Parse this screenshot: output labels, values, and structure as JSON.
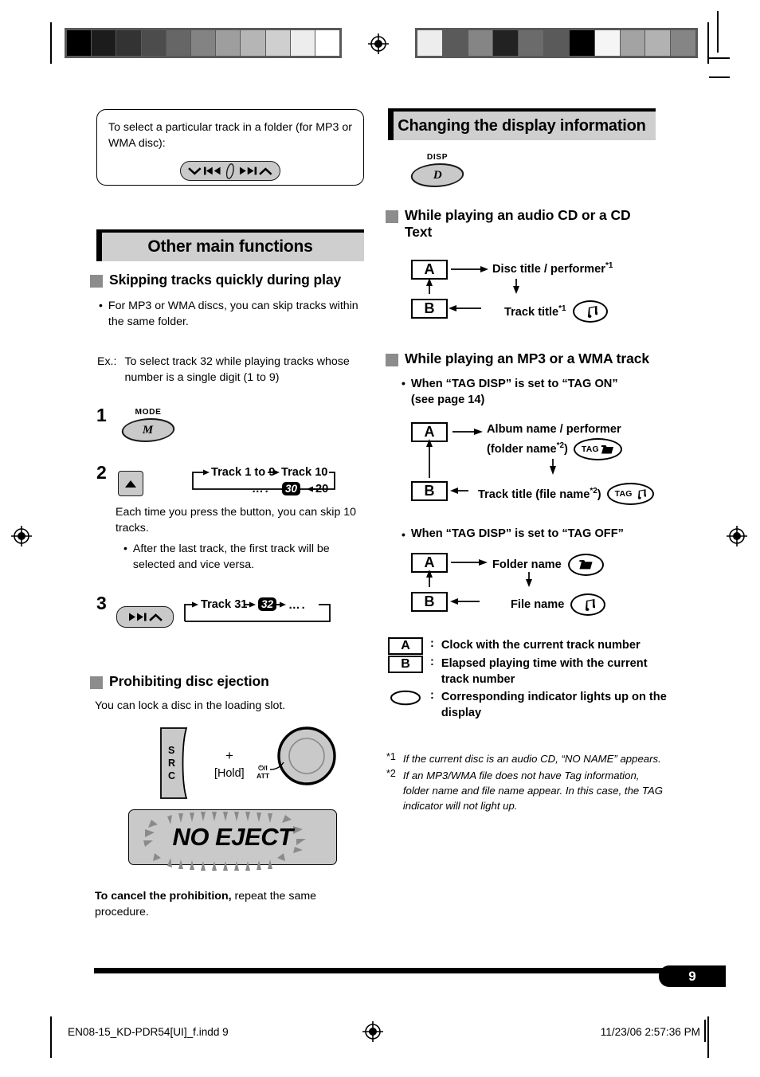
{
  "page": {
    "number": "9",
    "footer_file": "EN08-15_KD-PDR54[UI]_f.indd   9",
    "footer_date": "11/23/06   2:57:36 PM"
  },
  "left_column": {
    "intro_note": {
      "text": "To select a particular track in a folder (for MP3 or WMA disc):",
      "key_icon": "rocker-skip-key"
    },
    "banner": {
      "title": "Other main functions"
    },
    "section1": {
      "heading": "Skipping tracks quickly during play",
      "bullet": "For MP3 or WMA discs, you can skip tracks within the same folder.",
      "example_label": "Ex.:",
      "example_text": "To select track 32 while playing tracks whose number is a single digit (1 to 9)",
      "step1": {
        "num": "1",
        "key_label": "MODE",
        "key_glyph": "M"
      },
      "step2": {
        "num": "2",
        "key_icon": "up-arrow-key",
        "flow_top": [
          "Track 1 to 9",
          "Track 10"
        ],
        "flow_bottom": [
          "….",
          "30",
          "20"
        ],
        "text": "Each time you press the button, you can skip 10 tracks.",
        "bullet": "After the last track, the first track will be selected and vice versa."
      },
      "step3": {
        "num": "3",
        "key_icon": "fast-forward-key",
        "flow": [
          "Track 31",
          "32",
          "…."
        ]
      }
    },
    "section2": {
      "heading": "Prohibiting disc ejection",
      "text": "You can lock a disc in the loading slot.",
      "src_label": "SRC",
      "plus": "+",
      "hold_label": "[Hold]",
      "knob_label_top": "⏻/I",
      "knob_label_bottom": "ATT",
      "display_text": "NO EJECT",
      "cancel_bold": "To cancel the prohibition,",
      "cancel_rest": " repeat the same procedure."
    }
  },
  "right_column": {
    "banner": {
      "title": "Changing the display information"
    },
    "disp_key": {
      "label": "DISP",
      "glyph": "D"
    },
    "section1": {
      "heading": "While playing an audio CD or a CD Text",
      "a_box": "A",
      "b_box": "B",
      "a_target": "Disc title / performer",
      "a_target_note": "*1",
      "b_target": "Track title",
      "b_target_note": "*1",
      "b_indicator": "music-note-indicator"
    },
    "section2": {
      "heading": "While playing an MP3 or a WMA track",
      "tag_on": {
        "bullet_line1": "When “TAG DISP” is set to “TAG ON”",
        "bullet_line2": "(see page 14)",
        "a_box": "A",
        "b_box": "B",
        "a_target_line1": "Album name / performer",
        "a_target_line2": "(folder name",
        "a_target_note": "*2",
        "a_target_line2_end": ")",
        "a_indicator_text": "TAG",
        "a_indicator_icon": "folder-icon",
        "b_target": "Track title (file name",
        "b_target_note": "*2",
        "b_target_end": ")",
        "b_indicator_text": "TAG",
        "b_indicator_icon": "music-note-icon"
      },
      "tag_off": {
        "bullet": "When “TAG DISP” is set to “TAG OFF”",
        "a_box": "A",
        "b_box": "B",
        "a_target": "Folder name",
        "a_indicator": "folder-indicator",
        "b_target": "File name",
        "b_indicator": "music-note-indicator"
      }
    },
    "legend": [
      {
        "symbol": "A",
        "type": "box",
        "colon": ":",
        "text": "Clock with the current track number"
      },
      {
        "symbol": "B",
        "type": "box",
        "colon": ":",
        "text": "Elapsed playing time with the current track number"
      },
      {
        "symbol": "",
        "type": "oval",
        "colon": ":",
        "text": "Corresponding indicator lights up on the display"
      }
    ],
    "footnotes": [
      {
        "mark": "*1",
        "text": "If the current disc is an audio CD, “NO NAME” appears."
      },
      {
        "mark": "*2",
        "text": "If an MP3/WMA file does not have Tag information, folder name and file name appear. In this case, the TAG indicator will not light up."
      }
    ]
  },
  "registration": {
    "left_bar_swatches": [
      "#000000",
      "#1c1c1c",
      "#333333",
      "#4c4c4c",
      "#666666",
      "#838383",
      "#9e9e9e",
      "#b5b5b5",
      "#cfcfcf",
      "#ededed",
      "#ffffff"
    ],
    "right_bar_swatches": [
      "#ededed",
      "#5a5a5a",
      "#858585",
      "#222222",
      "#6b6b6b",
      "#5a5a5a",
      "#000000",
      "#f5f5f5",
      "#a3a3a3",
      "#b2b2b2",
      "#858585"
    ]
  }
}
